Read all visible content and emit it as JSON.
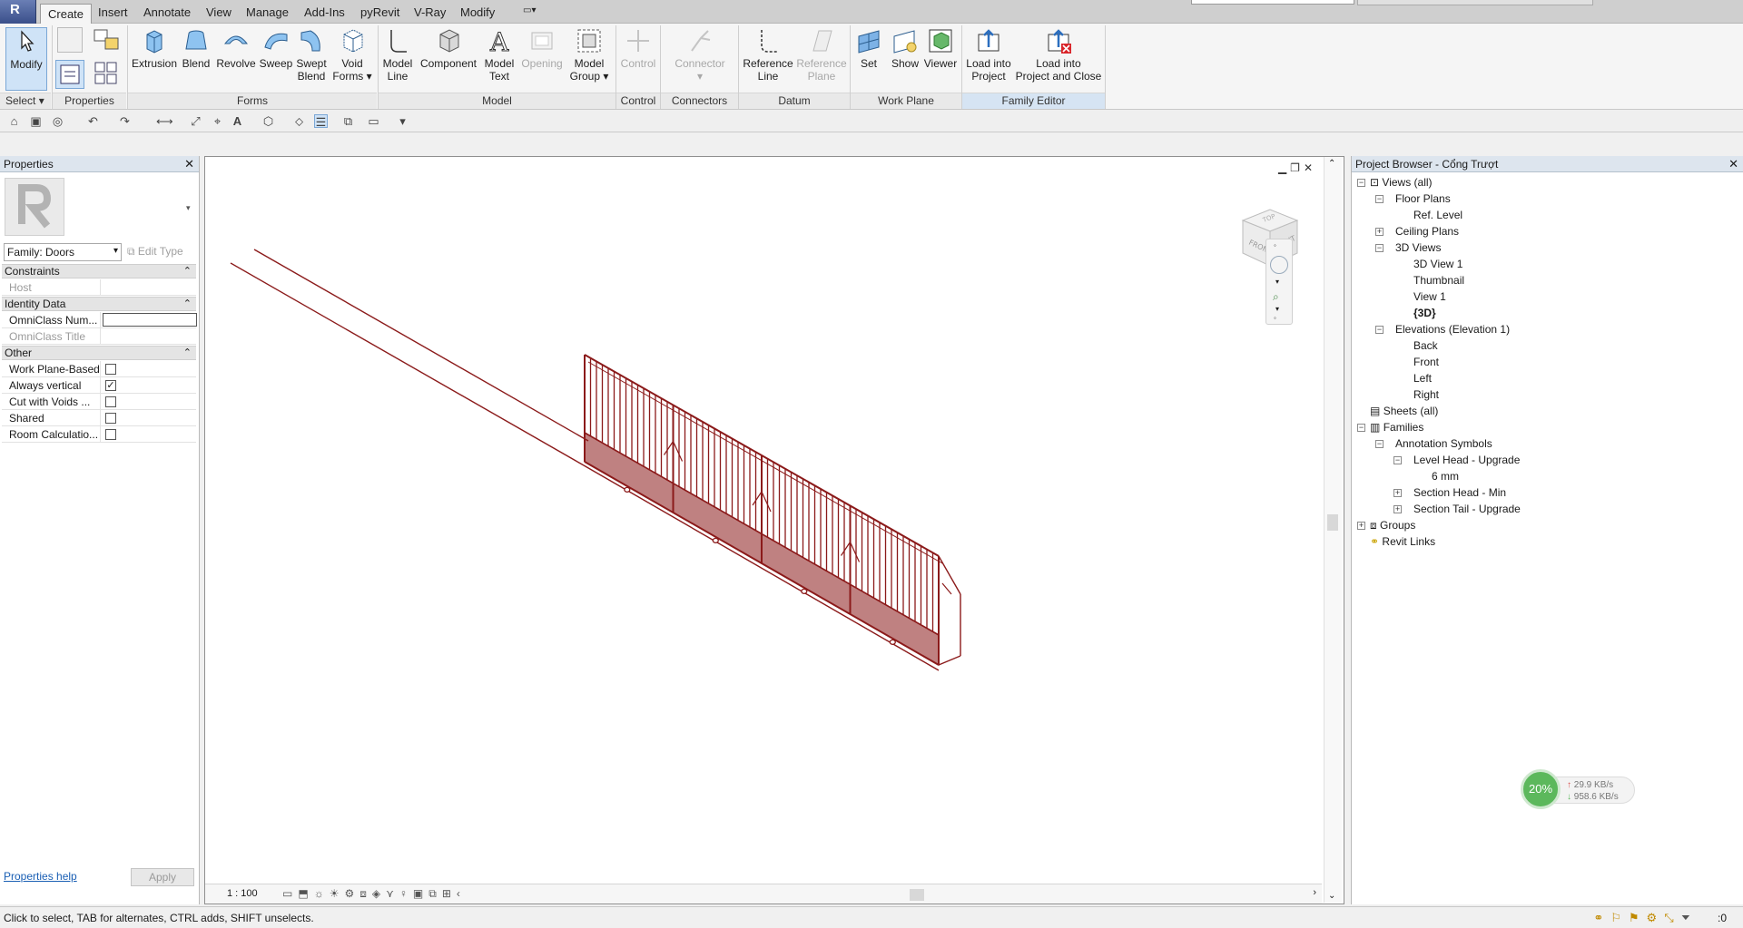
{
  "menubar": {
    "tabs": [
      "Create",
      "Insert",
      "Annotate",
      "View",
      "Manage",
      "Add-Ins",
      "pyRevit",
      "V-Ray",
      "Modify"
    ],
    "active_tab": "Create"
  },
  "ribbon": {
    "select_label": "Select",
    "modify_label": "Modify",
    "properties_panel": "Properties",
    "forms": {
      "title": "Forms",
      "extrusion": "Extrusion",
      "blend": "Blend",
      "revolve": "Revolve",
      "sweep": "Sweep",
      "swept_blend": [
        "Swept",
        "Blend"
      ],
      "void_forms": [
        "Void",
        "Forms"
      ]
    },
    "model": {
      "title": "Model",
      "model_line": [
        "Model",
        "Line"
      ],
      "component": "Component",
      "model_text": [
        "Model",
        "Text"
      ],
      "opening": "Opening",
      "model_group": [
        "Model",
        "Group"
      ]
    },
    "control": {
      "title": "Control",
      "control": "Control"
    },
    "connectors": {
      "title": "Connectors",
      "connector": "Connector"
    },
    "datum": {
      "title": "Datum",
      "reference_line": [
        "Reference",
        "Line"
      ],
      "reference_plane": [
        "Reference",
        "Plane"
      ]
    },
    "work_plane": {
      "title": "Work Plane",
      "set": "Set",
      "show": "Show",
      "viewer": "Viewer"
    },
    "family_editor": {
      "title": "Family Editor",
      "load_into_project": [
        "Load into",
        "Project"
      ],
      "load_into_project_close": [
        "Load into",
        "Project and Close"
      ]
    }
  },
  "properties": {
    "title": "Properties",
    "family_type": "Family: Doors",
    "edit_type": "Edit Type",
    "groups": {
      "constraints": "Constraints",
      "identity": "Identity Data",
      "other": "Other"
    },
    "rows": {
      "host": "Host",
      "omniclass_num": "OmniClass Num...",
      "omniclass_title": "OmniClass Title",
      "work_plane_based": "Work Plane-Based",
      "always_vertical": "Always vertical",
      "cut_with_voids": "Cut with Voids ...",
      "shared": "Shared",
      "room_calculation": "Room Calculatio..."
    },
    "checks": {
      "work_plane_based": false,
      "always_vertical": true,
      "cut_with_voids": false,
      "shared": false,
      "room_calculation": false
    },
    "help": "Properties help",
    "apply": "Apply"
  },
  "viewport": {
    "scale": "1 : 100",
    "model_color": "#8b1a1a"
  },
  "browser": {
    "title": "Project Browser - Cổng Trượt",
    "nodes": {
      "views_all": "Views (all)",
      "floor_plans": "Floor Plans",
      "ref_level": "Ref. Level",
      "ceiling_plans": "Ceiling Plans",
      "views_3d": "3D Views",
      "view_3d_1": "3D View 1",
      "thumbnail": "Thumbnail",
      "view_1": "View 1",
      "view_3d_cur": "{3D}",
      "elevations": "Elevations (Elevation 1)",
      "back": "Back",
      "front": "Front",
      "left": "Left",
      "right": "Right",
      "sheets": "Sheets (all)",
      "families": "Families",
      "annotation_symbols": "Annotation Symbols",
      "level_head": "Level Head - Upgrade",
      "six_mm": "6 mm",
      "section_head": "Section Head - Min",
      "section_tail": "Section Tail - Upgrade",
      "groups": "Groups",
      "revit_links": "Revit Links"
    }
  },
  "network": {
    "percent": "20%",
    "up": "29.9 KB/s",
    "down": "958.6 KB/s"
  },
  "status": {
    "text": "Click to select, TAB for alternates, CTRL adds, SHIFT unselects.",
    "filter_count": ":0"
  }
}
